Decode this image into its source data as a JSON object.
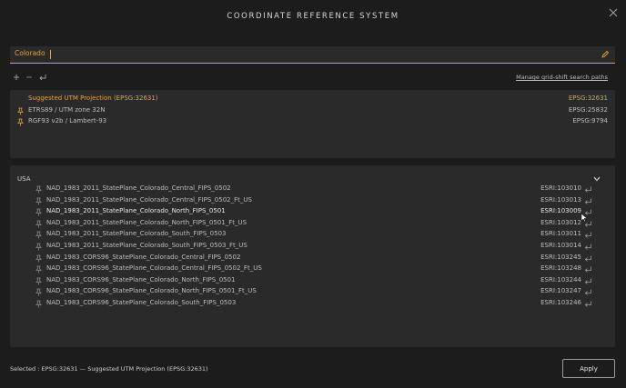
{
  "dialog": {
    "title": "COORDINATE REFERENCE SYSTEM",
    "close_icon": "close-icon"
  },
  "search": {
    "value": "Colorado",
    "edit_icon": "pencil-icon"
  },
  "toolbar": {
    "add_label": "+",
    "remove_label": "−",
    "manage_link": "Manage grid-shift search paths"
  },
  "favorites": [
    {
      "name": "Suggested UTM Projection (EPSG:32631)",
      "code": "EPSG:32631",
      "suggested": true
    },
    {
      "name": "ETRS89 / UTM zone 32N",
      "code": "EPSG:25832",
      "suggested": false
    },
    {
      "name": "RGF93 v2b / Lambert-93",
      "code": "EPSG:9794",
      "suggested": false
    }
  ],
  "results": {
    "group": "USA",
    "items": [
      {
        "name": "NAD_1983_2011_StatePlane_Colorado_Central_FIPS_0502",
        "code": "ESRI:103010"
      },
      {
        "name": "NAD_1983_2011_StatePlane_Colorado_Central_FIPS_0502_Ft_US",
        "code": "ESRI:103013"
      },
      {
        "name": "NAD_1983_2011_StatePlane_Colorado_North_FIPS_0501",
        "code": "ESRI:103009",
        "highlighted": true
      },
      {
        "name": "NAD_1983_2011_StatePlane_Colorado_North_FIPS_0501_Ft_US",
        "code": "ESRI:103012"
      },
      {
        "name": "NAD_1983_2011_StatePlane_Colorado_South_FIPS_0503",
        "code": "ESRI:103011"
      },
      {
        "name": "NAD_1983_2011_StatePlane_Colorado_South_FIPS_0503_Ft_US",
        "code": "ESRI:103014"
      },
      {
        "name": "NAD_1983_CORS96_StatePlane_Colorado_Central_FIPS_0502",
        "code": "ESRI:103245"
      },
      {
        "name": "NAD_1983_CORS96_StatePlane_Colorado_Central_FIPS_0502_Ft_US",
        "code": "ESRI:103248"
      },
      {
        "name": "NAD_1983_CORS96_StatePlane_Colorado_North_FIPS_0501",
        "code": "ESRI:103244"
      },
      {
        "name": "NAD_1983_CORS96_StatePlane_Colorado_North_FIPS_0501_Ft_US",
        "code": "ESRI:103247"
      },
      {
        "name": "NAD_1983_CORS96_StatePlane_Colorado_South_FIPS_0503",
        "code": "ESRI:103246"
      }
    ]
  },
  "footer": {
    "status": "Selected : EPSG:32631 — Suggested UTM Projection (EPSG:32631)",
    "apply_label": "Apply"
  },
  "colors": {
    "accent": "#e8a13a",
    "background": "#1c1c1c",
    "panel": "#2a2a2a"
  }
}
